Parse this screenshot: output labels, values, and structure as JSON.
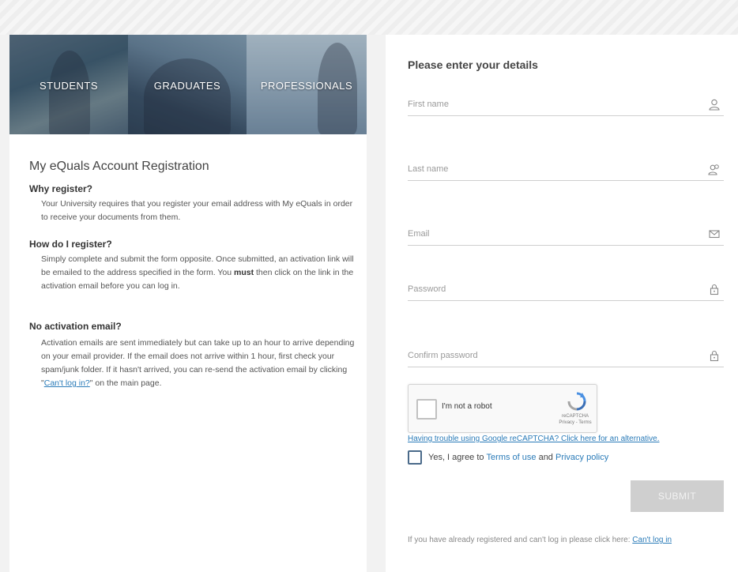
{
  "banner": {
    "segments": [
      "STUDENTS",
      "GRADUATES",
      "PROFESSIONALS"
    ]
  },
  "info": {
    "title": "My eQuals Account Registration",
    "sections": [
      {
        "heading": "Why register?",
        "body": "Your University requires that you register your email address with My eQuals in order to receive your documents from them."
      },
      {
        "heading": "How do I register?",
        "body_before": "Simply complete and submit the form opposite. Once submitted, an activation link will be emailed to the address specified in the form. You ",
        "body_bold": "must",
        "body_after": " then click on the link in the activation email before you can log in."
      },
      {
        "heading": "No activation email?",
        "body_before": "Activation emails are sent immediately but can take up to an hour to arrive depending on your email provider. If the email does not arrive within 1 hour, first check your spam/junk folder. If it hasn't arrived, you can re-send the activation email by clicking \"",
        "link": "Can't log in?",
        "body_after": "\" on the main page."
      }
    ]
  },
  "form": {
    "title": "Please enter your details",
    "fields": [
      {
        "placeholder": "First name",
        "icon": "user-icon"
      },
      {
        "placeholder": "Last name",
        "icon": "users-icon"
      },
      {
        "placeholder": "Email",
        "icon": "envelope-icon"
      },
      {
        "placeholder": "Password",
        "icon": "lock-icon"
      },
      {
        "placeholder": "Confirm password",
        "icon": "lock-icon"
      }
    ],
    "captcha": {
      "label": "I'm not a robot",
      "brand": "reCAPTCHA",
      "links": "Privacy - Terms"
    },
    "captcha_alt_link": "Having trouble using Google reCAPTCHA? Click here for an alternative.",
    "agree": {
      "prefix": "Yes, I agree to ",
      "terms": "Terms of use",
      "and": " and ",
      "privacy": "Privacy policy"
    },
    "submit_label": "SUBMIT",
    "footer": {
      "text": "If you have already registered and can't log in please click here: ",
      "link": "Can't log in"
    }
  },
  "colors": {
    "link": "#2a7bb8",
    "submit_bg": "#cfcfcf",
    "page_bg": "#f2f2f2"
  }
}
